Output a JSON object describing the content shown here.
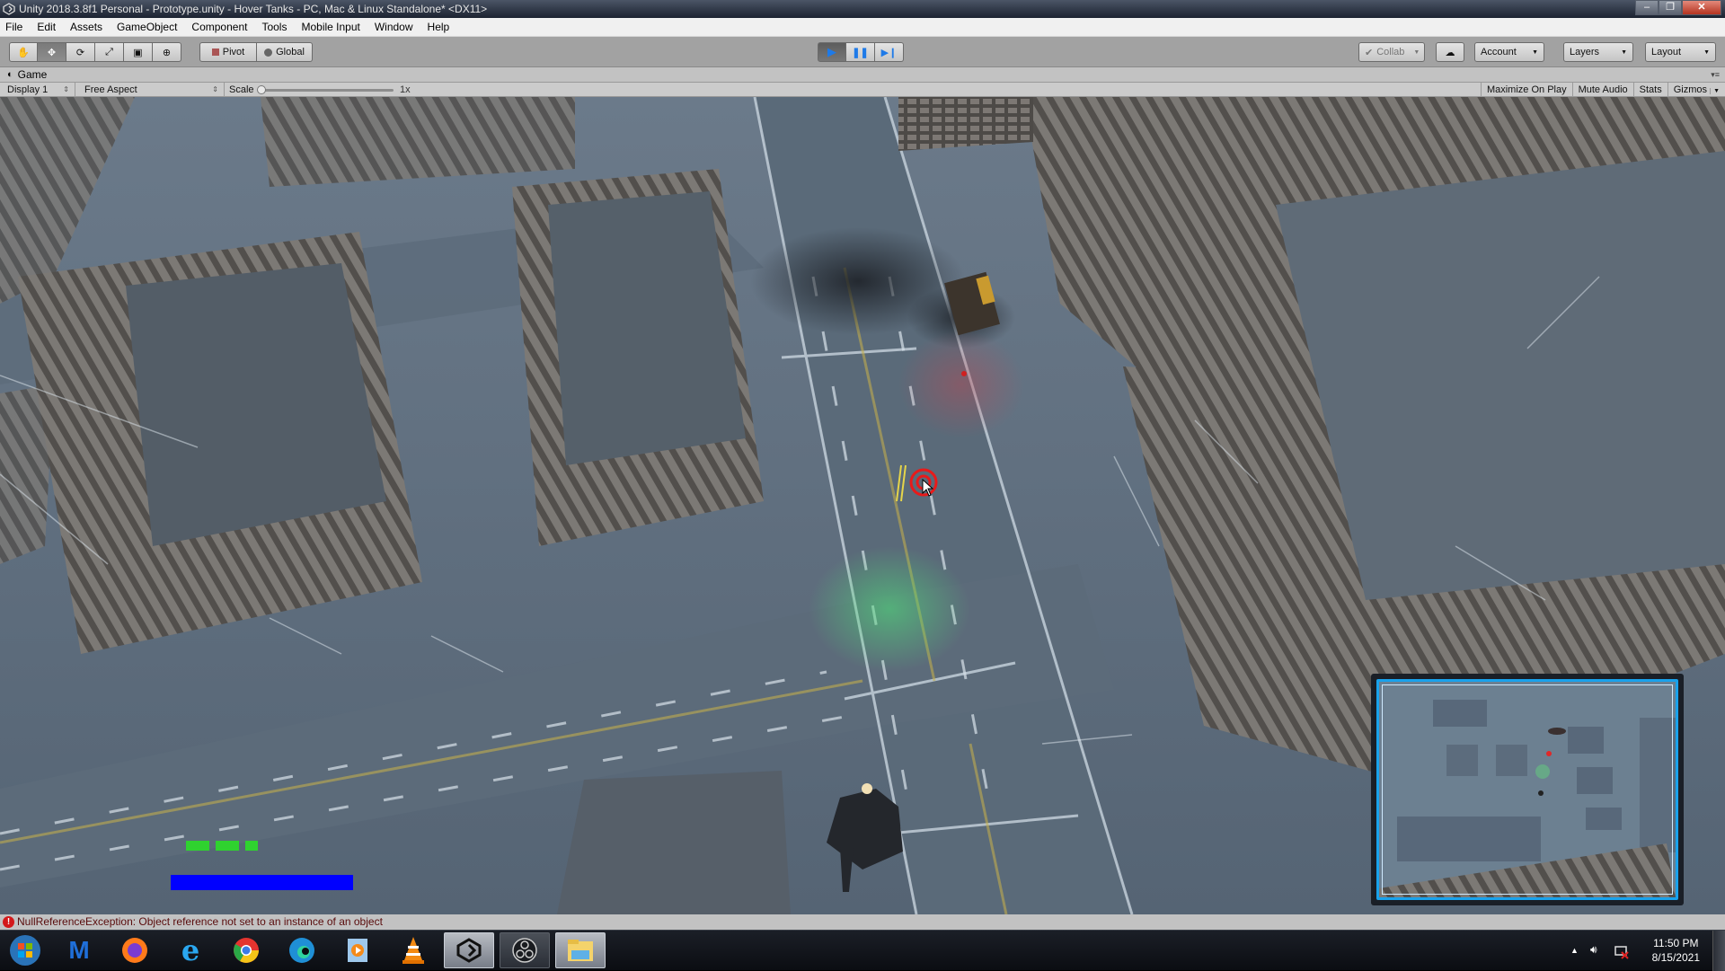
{
  "window": {
    "title": "Unity 2018.3.8f1 Personal - Prototype.unity - Hover Tanks - PC, Mac & Linux Standalone* <DX11>",
    "app_icon": "unity-icon",
    "controls": {
      "minimize": "–",
      "maximize": "❐",
      "close": "✕"
    }
  },
  "menu": {
    "items": [
      "File",
      "Edit",
      "Assets",
      "GameObject",
      "Component",
      "Tools",
      "Mobile Input",
      "Window",
      "Help"
    ]
  },
  "toolbar": {
    "transform_tools": [
      {
        "name": "hand-tool",
        "icon": "✋",
        "active": false
      },
      {
        "name": "move-tool",
        "icon": "✥",
        "active": true
      },
      {
        "name": "rotate-tool",
        "icon": "⟳",
        "active": false
      },
      {
        "name": "scale-tool",
        "icon": "⤢",
        "active": false
      },
      {
        "name": "rect-tool",
        "icon": "▣",
        "active": false
      },
      {
        "name": "transform-tool",
        "icon": "⊕",
        "active": false
      }
    ],
    "pivot_label": "Pivot",
    "global_label": "Global",
    "play": {
      "play_icon": "▶",
      "pause_icon": "❚❚",
      "step_icon": "▶❙",
      "playing": true
    },
    "collab_label": "Collab",
    "cloud_icon": "☁",
    "account_label": "Account",
    "layers_label": "Layers",
    "layout_label": "Layout",
    "accent_color": "#1e7ae8"
  },
  "game_panel": {
    "tab_label": "Game",
    "display_option": "Display 1",
    "aspect_option": "Free Aspect",
    "scale_label": "Scale",
    "scale_value": "1x",
    "toggles": [
      "Maximize On Play",
      "Mute Audio",
      "Stats",
      "Gizmos"
    ]
  },
  "hud": {
    "ammo": {
      "pips_full": 2,
      "pips_partial": 1,
      "color": "#2fd22f"
    },
    "health": {
      "fraction": 1.0,
      "color": "#0000ff"
    },
    "minimap": {
      "frame_color": "#19a2ec"
    },
    "crosshair_color": "#e81a1a"
  },
  "console": {
    "level": "error",
    "message": "NullReferenceException: Object reference not set to an instance of an object"
  },
  "taskbar": {
    "items": [
      {
        "name": "start-button",
        "icon": "windows-logo"
      },
      {
        "name": "malwarebytes",
        "icon": "M"
      },
      {
        "name": "firefox",
        "icon": "firefox"
      },
      {
        "name": "internet-explorer",
        "icon": "e"
      },
      {
        "name": "chrome",
        "icon": "chrome"
      },
      {
        "name": "edge",
        "icon": "edge"
      },
      {
        "name": "media-player",
        "icon": "▶"
      },
      {
        "name": "vlc",
        "icon": "vlc-cone"
      },
      {
        "name": "unity",
        "icon": "unity",
        "running": true
      },
      {
        "name": "obs",
        "icon": "obs",
        "running": true
      },
      {
        "name": "file-explorer",
        "icon": "folder",
        "running": true
      }
    ],
    "clock_time": "11:50 PM",
    "clock_date": "8/15/2021"
  }
}
